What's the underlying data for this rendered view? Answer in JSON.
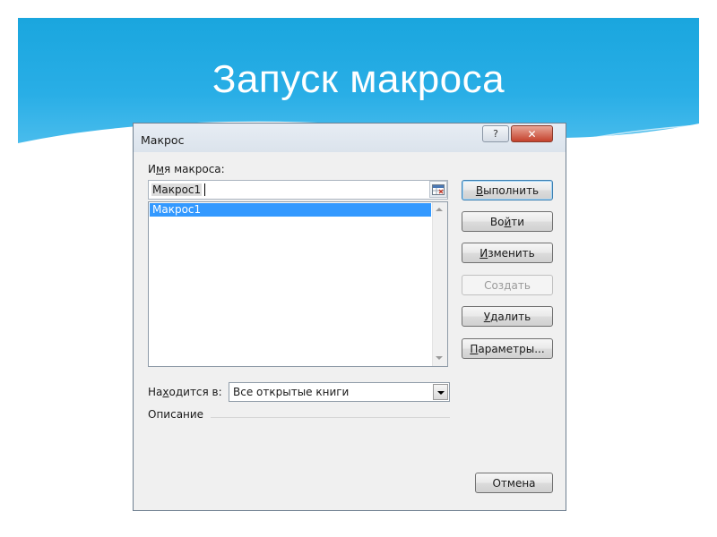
{
  "slide": {
    "title": "Запуск макроса"
  },
  "dialog": {
    "title": "Макрос",
    "help_label": "?",
    "close_label": "✕",
    "macro_name_label_pre": "И",
    "macro_name_label_accel": "м",
    "macro_name_label_post": "я макроса:",
    "macro_name_value": "Макрос1",
    "macros": [
      "Макрос1"
    ],
    "buttons": {
      "run": {
        "pre": "",
        "accel": "В",
        "post": "ыполнить"
      },
      "step_into": {
        "pre": "Во",
        "accel": "й",
        "post": "ти"
      },
      "edit": {
        "pre": "",
        "accel": "И",
        "post": "зменить"
      },
      "create": {
        "pre": "",
        "accel": "",
        "post": "Создать"
      },
      "delete": {
        "pre": "",
        "accel": "У",
        "post": "далить"
      },
      "options": {
        "pre": "",
        "accel": "П",
        "post": "араметры..."
      },
      "cancel": {
        "pre": "",
        "accel": "",
        "post": "Отмена"
      }
    },
    "location_label_pre": "На",
    "location_label_accel": "х",
    "location_label_post": "одится в:",
    "location_value": "Все открытые книги",
    "description_label": "Описание"
  }
}
